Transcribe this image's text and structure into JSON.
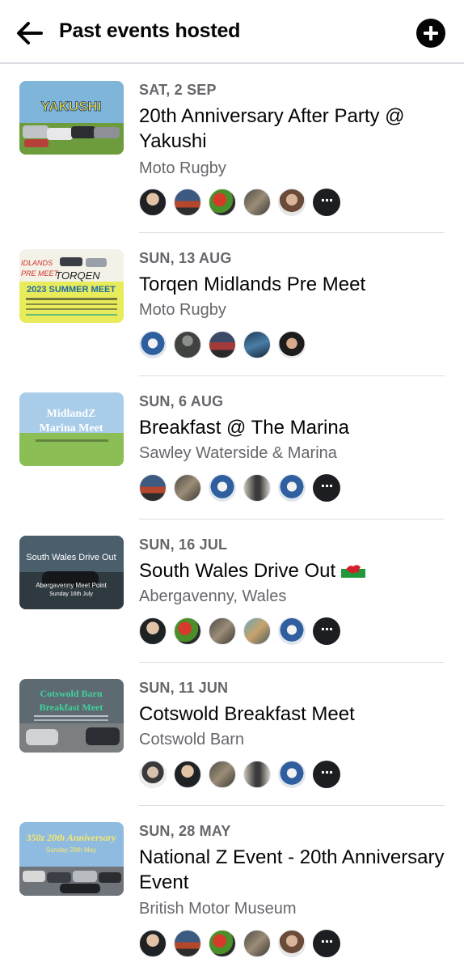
{
  "header": {
    "title": "Past events hosted",
    "back_icon": "arrow-left-icon",
    "add_icon": "plus-circle-icon"
  },
  "events": [
    {
      "date": "SAT, 2 SEP",
      "title": "20th Anniversary After Party @ Yakushi",
      "location": "Moto Rugby",
      "thumb_text": "YAKUSHI",
      "attendee_count_shown": 5,
      "has_more": true
    },
    {
      "date": "SUN, 13 AUG",
      "title": "Torqen Midlands Pre Meet",
      "location": "Moto Rugby",
      "thumb_text": "2023 SUMMER MEET",
      "attendee_count_shown": 5,
      "has_more": false
    },
    {
      "date": "SUN, 6 AUG",
      "title": "Breakfast @ The Marina",
      "location": "Sawley Waterside & Marina",
      "thumb_text": "MidlandZ Marina Meet",
      "attendee_count_shown": 5,
      "has_more": true
    },
    {
      "date": "SUN, 16 JUL",
      "title": "South Wales Drive Out",
      "title_emoji": "welsh-flag",
      "location": "Abergavenny, Wales",
      "thumb_text": "South Wales Drive Out",
      "attendee_count_shown": 5,
      "has_more": true
    },
    {
      "date": "SUN, 11 JUN",
      "title": "Cotswold Breakfast Meet",
      "location": "Cotswold Barn",
      "thumb_text": "Cotswold Barn Breakfast Meet",
      "attendee_count_shown": 5,
      "has_more": true
    },
    {
      "date": "SUN, 28 MAY",
      "title": "National Z Event - 20th Anniversary Event",
      "location": "British Motor Museum",
      "thumb_text": "350z 20th Anniversary",
      "attendee_count_shown": 5,
      "has_more": true
    }
  ],
  "colors": {
    "text_primary": "#050505",
    "text_secondary": "#65676b",
    "divider": "#dadde1"
  }
}
